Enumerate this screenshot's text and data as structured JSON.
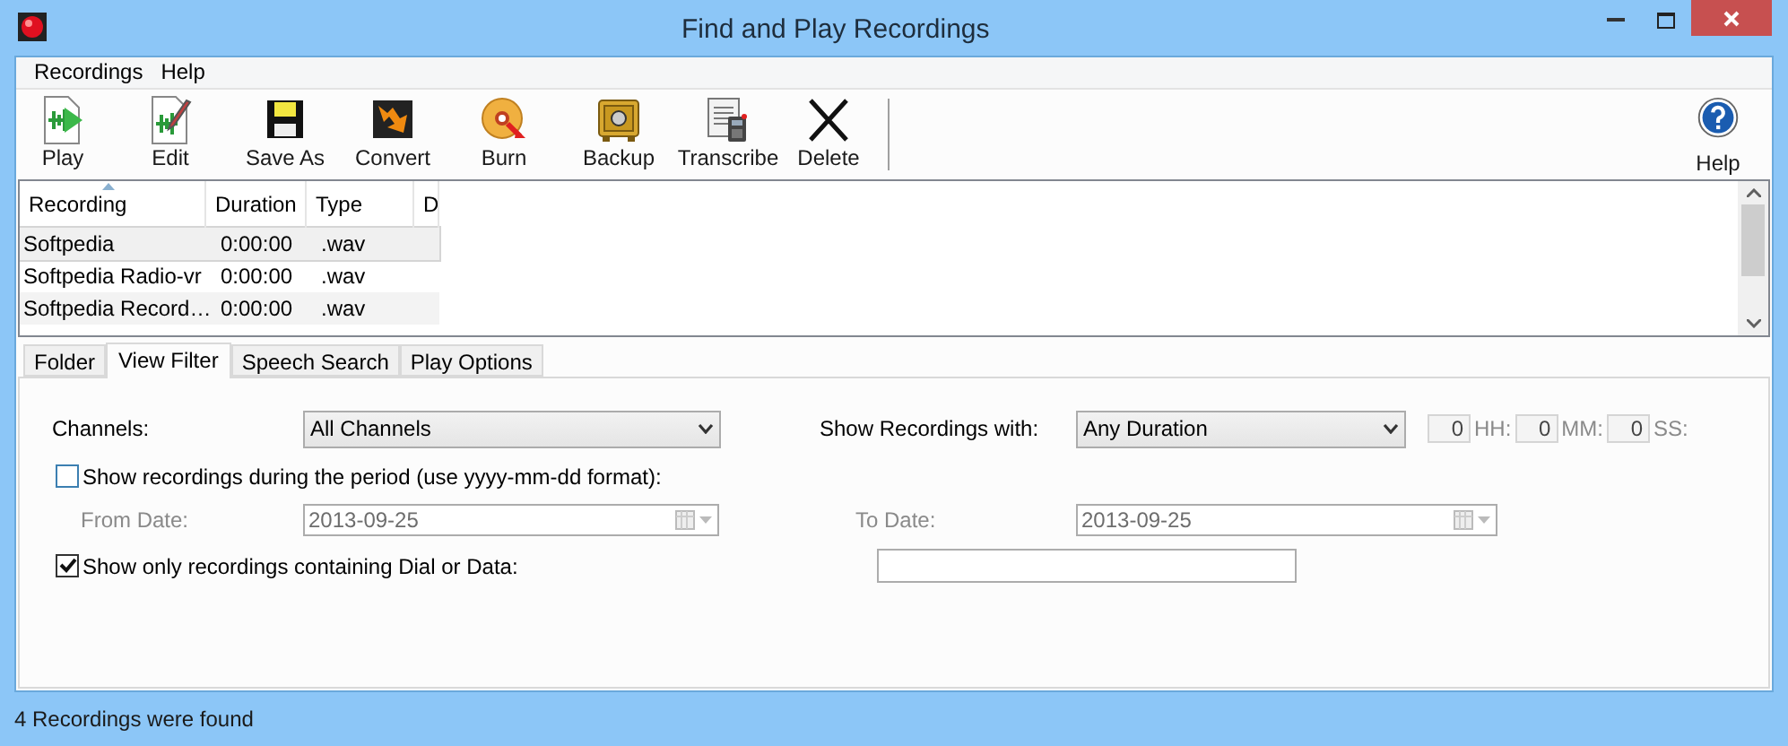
{
  "window": {
    "title": "Find and Play Recordings"
  },
  "menu": [
    "Recordings",
    "Help"
  ],
  "toolbar": [
    {
      "label": "Play"
    },
    {
      "label": "Edit"
    },
    {
      "label": "Save As"
    },
    {
      "label": "Convert"
    },
    {
      "label": "Burn"
    },
    {
      "label": "Backup"
    },
    {
      "label": "Transcribe"
    },
    {
      "label": "Delete"
    }
  ],
  "help_button": {
    "label": "Help"
  },
  "table": {
    "columns": [
      "Recording",
      "Duration",
      "Type",
      "D"
    ],
    "rows": [
      {
        "cells": [
          "Softpedia",
          "0:00:00",
          ".wav"
        ],
        "selected": true
      },
      {
        "cells": [
          "Softpedia Radio-vr",
          "0:00:00",
          ".wav"
        ],
        "selected": false
      },
      {
        "cells": [
          "Softpedia Record…",
          "0:00:00",
          ".wav"
        ],
        "selected": false
      }
    ]
  },
  "tabs": [
    {
      "label": "Folder",
      "selected": false
    },
    {
      "label": "View Filter",
      "selected": true
    },
    {
      "label": "Speech Search",
      "selected": false
    },
    {
      "label": "Play Options",
      "selected": false
    }
  ],
  "filter": {
    "channels": {
      "label": "Channels:",
      "value": "All Channels"
    },
    "duration": {
      "label": "Show Recordings with:",
      "value": "Any Duration",
      "fields": [
        {
          "value": "0",
          "unit": "HH:"
        },
        {
          "value": "0",
          "unit": "MM:"
        },
        {
          "value": "0",
          "unit": "SS:"
        }
      ]
    },
    "period": {
      "label": "Show recordings during the period (use yyyy-mm-dd format):",
      "checked": false,
      "from": {
        "label": "From Date:",
        "value": "2013-09-25"
      },
      "to": {
        "label": "To Date:",
        "value": "2013-09-25"
      }
    },
    "dial": {
      "label": "Show only recordings containing Dial or Data:",
      "checked": true
    }
  },
  "status_bar": "4 Recordings were found"
}
